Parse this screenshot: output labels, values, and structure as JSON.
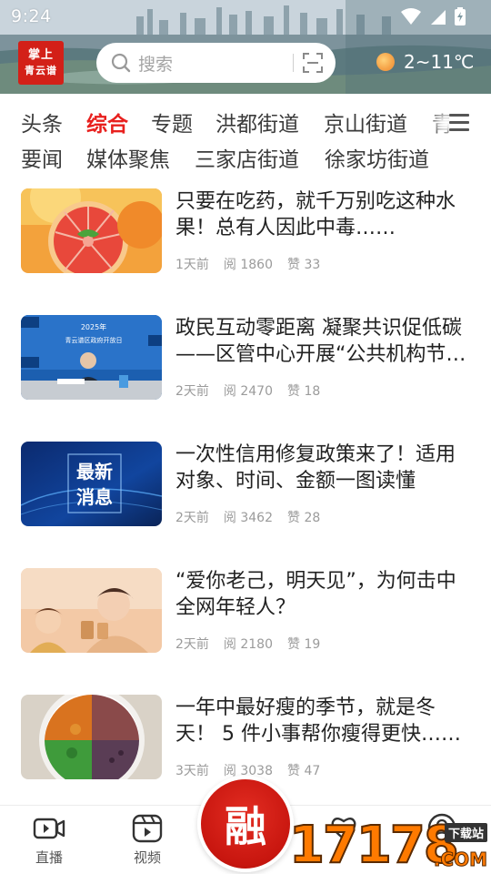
{
  "status_bar": {
    "time": "9:24"
  },
  "header": {
    "logo_line1": "掌上",
    "logo_line2": "青云谱",
    "search_placeholder": "搜索",
    "weather": "2~11℃"
  },
  "tabs": {
    "row1": [
      "头条",
      "综合",
      "专题",
      "洪都街道",
      "京山街道",
      "青"
    ],
    "row2": [
      "要闻",
      "媒体聚焦",
      "三家店街道",
      "徐家坊街道"
    ],
    "active": "综合"
  },
  "news": [
    {
      "title": "只要在吃药，就千万别吃这种水果！总有人因此中毒……",
      "time": "1天前",
      "reads": "阅 1860",
      "likes": "赞 33",
      "thumb": "grapefruit"
    },
    {
      "title": "政民互动零距离 凝聚共识促低碳——区管中心开展“公共机构节能”政府开放日活动",
      "time": "2天前",
      "reads": "阅 2470",
      "likes": "赞 18",
      "thumb": "conference"
    },
    {
      "title": "一次性信用修复政策来了！适用对象、时间、金额一图读懂",
      "time": "2天前",
      "reads": "阅 3462",
      "likes": "赞 28",
      "thumb": "latest-news"
    },
    {
      "title": "“爱你老己，明天见”，为何击中全网年轻人？",
      "time": "2天前",
      "reads": "阅 2180",
      "likes": "赞 19",
      "thumb": "illustration"
    },
    {
      "title": "一年中最好瘦的季节，就是冬天！ 5 件小事帮你瘦得更快……",
      "time": "3天前",
      "reads": "阅 3038",
      "likes": "赞 47",
      "thumb": "food-plate"
    }
  ],
  "thumb_texts": {
    "conference_banner_year": "2025年",
    "conference_banner_title": "青云谱区政府开放日",
    "latest_news_line1": "最新",
    "latest_news_line2": "消息"
  },
  "bottom_nav": {
    "live": "直播",
    "video": "视频",
    "center": "融"
  },
  "watermark": {
    "digits": "17178",
    "download": "下载站",
    "com": ".COM"
  },
  "colors": {
    "accent": "#e8201e",
    "brand_red": "#d32018",
    "meta_gray": "#9b9b9b"
  }
}
